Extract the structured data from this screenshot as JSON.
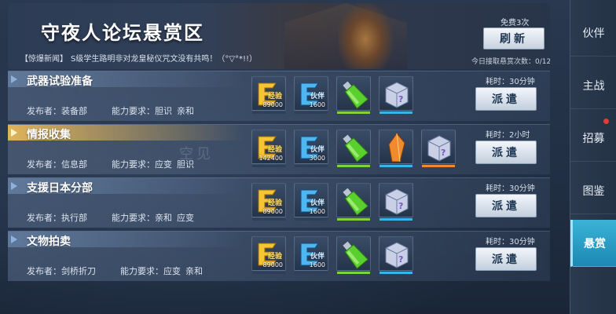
{
  "banner": {
    "title": "守夜人论坛悬赏区",
    "news_tag": "【惊爆新闻】",
    "news_text": "S级学生路明非对龙皇秘仪咒文没有共鸣！（°▽°*!!）",
    "free_label": "免费3次",
    "refresh_label": "刷新",
    "today_count_label": "今日接取悬赏次数：",
    "today_count_value": "0/12"
  },
  "labels": {
    "publisher": "发布者：",
    "requirement": "能力要求：",
    "dispatch": "派遣"
  },
  "tasks": [
    {
      "name": "武器试验准备",
      "publisher": "装备部",
      "req1": "胆识",
      "req2": "亲和",
      "duration": "耗时：30分钟",
      "rewards": [
        {
          "icon": "exp-icon",
          "tag": "经验",
          "qty": "89000",
          "bar": "#2e3f58"
        },
        {
          "icon": "partner-exp-icon",
          "tag": "伙伴",
          "qty": "1600",
          "bar": "#2e3f58"
        },
        {
          "icon": "green-potion-icon",
          "qty": "",
          "bar": "#7fd33a"
        },
        {
          "icon": "mystery-box-icon",
          "qty": "",
          "bar": "#3ab4e6"
        }
      ]
    },
    {
      "name": "情报收集",
      "publisher": "信息部",
      "req1": "应变",
      "req2": "胆识",
      "duration": "耗时：2小时",
      "rewards": [
        {
          "icon": "exp-icon",
          "tag": "经验",
          "qty": "142400",
          "bar": "#2e3f58"
        },
        {
          "icon": "partner-exp-icon",
          "tag": "伙伴",
          "qty": "3000",
          "bar": "#2e3f58"
        },
        {
          "icon": "green-potion-icon",
          "qty": "",
          "bar": "#7fd33a"
        },
        {
          "icon": "orange-crystal-icon",
          "qty": "",
          "bar": "#3ab4e6"
        },
        {
          "icon": "mystery-box-icon",
          "qty": "",
          "bar": "#f08a2c"
        }
      ]
    },
    {
      "name": "支援日本分部",
      "publisher": "执行部",
      "req1": "亲和",
      "req2": "应变",
      "duration": "耗时：30分钟",
      "rewards": [
        {
          "icon": "exp-icon",
          "tag": "经验",
          "qty": "89000",
          "bar": "#2e3f58"
        },
        {
          "icon": "partner-exp-icon",
          "tag": "伙伴",
          "qty": "1600",
          "bar": "#2e3f58"
        },
        {
          "icon": "green-potion-icon",
          "qty": "",
          "bar": "#7fd33a"
        },
        {
          "icon": "mystery-box-icon",
          "qty": "",
          "bar": "#3ab4e6"
        }
      ]
    },
    {
      "name": "文物拍卖",
      "publisher": "剑桥折刀",
      "req1": "应变",
      "req2": "亲和",
      "duration": "耗时：30分钟",
      "rewards": [
        {
          "icon": "exp-icon",
          "tag": "经验",
          "qty": "89000",
          "bar": "#2e3f58"
        },
        {
          "icon": "partner-exp-icon",
          "tag": "伙伴",
          "qty": "1600",
          "bar": "#2e3f58"
        },
        {
          "icon": "green-potion-icon",
          "qty": "",
          "bar": "#7fd33a"
        },
        {
          "icon": "mystery-box-icon",
          "qty": "",
          "bar": "#3ab4e6"
        }
      ]
    }
  ],
  "watermark": "空见",
  "nav": [
    {
      "label": "伙伴",
      "active": false,
      "dot": false
    },
    {
      "label": "主战",
      "active": false,
      "dot": false
    },
    {
      "label": "招募",
      "active": false,
      "dot": true
    },
    {
      "label": "图鉴",
      "active": false,
      "dot": false
    },
    {
      "label": "悬赏",
      "active": true,
      "dot": false
    }
  ]
}
